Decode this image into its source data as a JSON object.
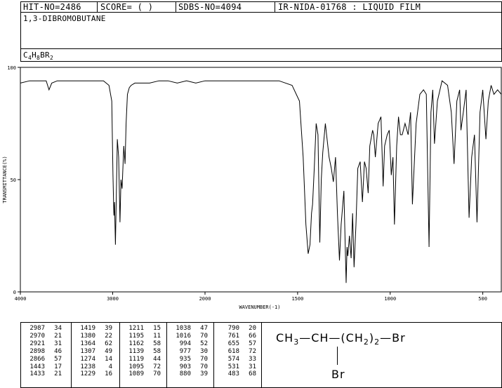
{
  "header": {
    "hit_no": "HIT-NO=2486",
    "score": "SCORE=  (   )",
    "sdbs_no": "SDBS-NO=4094",
    "ir_info": "IR-NIDA-01768 : LIQUID FILM"
  },
  "compound": {
    "name": "1,3-DIBROMOBUTANE",
    "formula_parts": [
      "C",
      "4",
      "H",
      "8",
      "BR",
      "2"
    ]
  },
  "chart_data": {
    "type": "line",
    "xlabel": "WAVENUMBER(-1)",
    "ylabel": "TRANSMITTANCE(%)",
    "xlim": [
      4000,
      400
    ],
    "ylim": [
      0,
      100
    ],
    "x_ticks": [
      4000,
      3000,
      2000,
      1500,
      1000,
      500
    ],
    "y_ticks": [
      0,
      50,
      100
    ],
    "grid": false,
    "series": [
      {
        "x": [
          4000,
          3900,
          3800,
          3720,
          3690,
          3660,
          3600,
          3500,
          3300,
          3100,
          3040,
          3010,
          2997,
          2987,
          2980,
          2970,
          2960,
          2950,
          2935,
          2921,
          2910,
          2898,
          2880,
          2866,
          2855,
          2840,
          2820,
          2800,
          2760,
          2700,
          2600,
          2500,
          2400,
          2300,
          2200,
          2100,
          2000,
          1900,
          1800,
          1700,
          1600,
          1530,
          1490,
          1470,
          1455,
          1443,
          1433,
          1425,
          1419,
          1410,
          1400,
          1390,
          1380,
          1372,
          1364,
          1350,
          1330,
          1318,
          1307,
          1295,
          1285,
          1274,
          1265,
          1250,
          1238,
          1233,
          1229,
          1220,
          1211,
          1203,
          1195,
          1185,
          1175,
          1162,
          1150,
          1139,
          1130,
          1119,
          1110,
          1095,
          1089,
          1080,
          1065,
          1050,
          1038,
          1030,
          1016,
          1005,
          994,
          985,
          977,
          965,
          955,
          945,
          935,
          920,
          903,
          890,
          880,
          860,
          840,
          820,
          805,
          790,
          780,
          770,
          761,
          745,
          720,
          690,
          670,
          655,
          640,
          625,
          618,
          605,
          590,
          574,
          560,
          545,
          531,
          515,
          500,
          483,
          470,
          455,
          440,
          420,
          400
        ],
        "y": [
          93,
          94,
          94,
          94,
          90,
          93,
          94,
          94,
          94,
          94,
          92,
          85,
          52,
          34,
          40,
          21,
          45,
          68,
          60,
          31,
          50,
          46,
          65,
          57,
          75,
          88,
          91,
          92,
          93,
          93,
          93,
          94,
          94,
          93,
          94,
          93,
          94,
          94,
          94,
          94,
          94,
          92,
          85,
          60,
          30,
          17,
          21,
          35,
          39,
          55,
          75,
          70,
          22,
          50,
          62,
          75,
          60,
          55,
          49,
          60,
          35,
          14,
          30,
          45,
          4,
          20,
          16,
          25,
          15,
          35,
          11,
          30,
          55,
          58,
          40,
          58,
          55,
          44,
          65,
          72,
          70,
          60,
          75,
          78,
          47,
          65,
          70,
          72,
          52,
          60,
          30,
          65,
          78,
          70,
          70,
          75,
          70,
          80,
          39,
          75,
          88,
          90,
          88,
          20,
          80,
          90,
          66,
          85,
          94,
          92,
          80,
          57,
          85,
          90,
          72,
          80,
          90,
          33,
          60,
          70,
          31,
          80,
          90,
          68,
          85,
          92,
          88,
          90,
          88
        ]
      }
    ]
  },
  "peak_table": {
    "columns": [
      [
        [
          "2987",
          "34"
        ],
        [
          "2970",
          "21"
        ],
        [
          "2921",
          "31"
        ],
        [
          "2898",
          "46"
        ],
        [
          "2866",
          "57"
        ],
        [
          "1443",
          "17"
        ],
        [
          "1433",
          "21"
        ]
      ],
      [
        [
          "1419",
          "39"
        ],
        [
          "1380",
          "22"
        ],
        [
          "1364",
          "62"
        ],
        [
          "1307",
          "49"
        ],
        [
          "1274",
          "14"
        ],
        [
          "1238",
          "4"
        ],
        [
          "1229",
          "16"
        ]
      ],
      [
        [
          "1211",
          "15"
        ],
        [
          "1195",
          "11"
        ],
        [
          "1162",
          "58"
        ],
        [
          "1139",
          "58"
        ],
        [
          "1119",
          "44"
        ],
        [
          "1095",
          "72"
        ],
        [
          "1089",
          "70"
        ]
      ],
      [
        [
          "1038",
          "47"
        ],
        [
          "1016",
          "70"
        ],
        [
          "994",
          "52"
        ],
        [
          "977",
          "30"
        ],
        [
          "935",
          "70"
        ],
        [
          "903",
          "70"
        ],
        [
          "880",
          "39"
        ]
      ],
      [
        [
          "790",
          "20"
        ],
        [
          "761",
          "66"
        ],
        [
          "655",
          "57"
        ],
        [
          "618",
          "72"
        ],
        [
          "574",
          "33"
        ],
        [
          "531",
          "31"
        ],
        [
          "483",
          "68"
        ]
      ]
    ]
  },
  "structure": {
    "ch3": "CH",
    "ch3_sub": "3",
    "ch": "CH",
    "paren_open": "(CH",
    "ch2_sub": "2",
    "paren_close": ")",
    "n_sub": "2",
    "br_end": "Br",
    "br_sub_label": "Br"
  }
}
